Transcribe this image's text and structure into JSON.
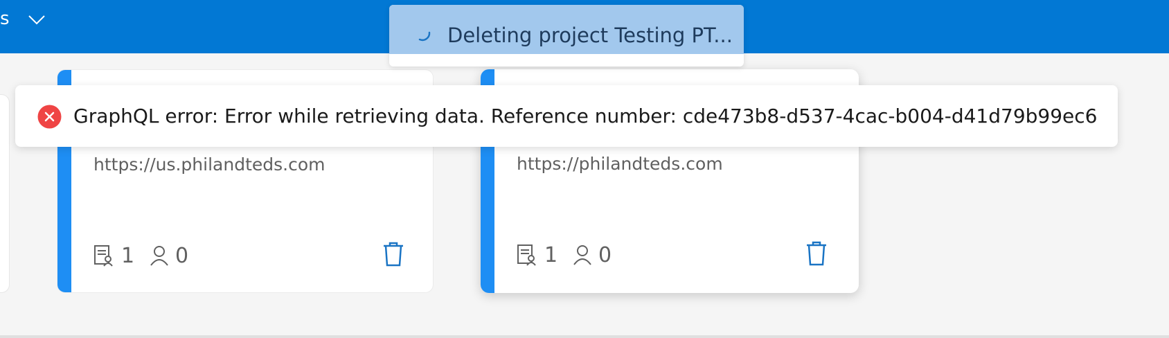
{
  "topbar": {
    "partial_text": "s",
    "color": "#0278d4"
  },
  "loading_toast": {
    "message": "Deleting project Testing PT..."
  },
  "error_toast": {
    "message": "GraphQL error: Error while retrieving data. Reference number: cde473b8-d537-4cac-b004-d41d79b99ec6",
    "icon": "error-circle-icon",
    "color": "#ef4444"
  },
  "cards": [
    {
      "url": "https://us.philandteds.com",
      "reports_count": "1",
      "users_count": "0"
    },
    {
      "url": "https://philandteds.com",
      "reports_count": "1",
      "users_count": "0"
    }
  ],
  "accent_color": "#1e8ef4"
}
